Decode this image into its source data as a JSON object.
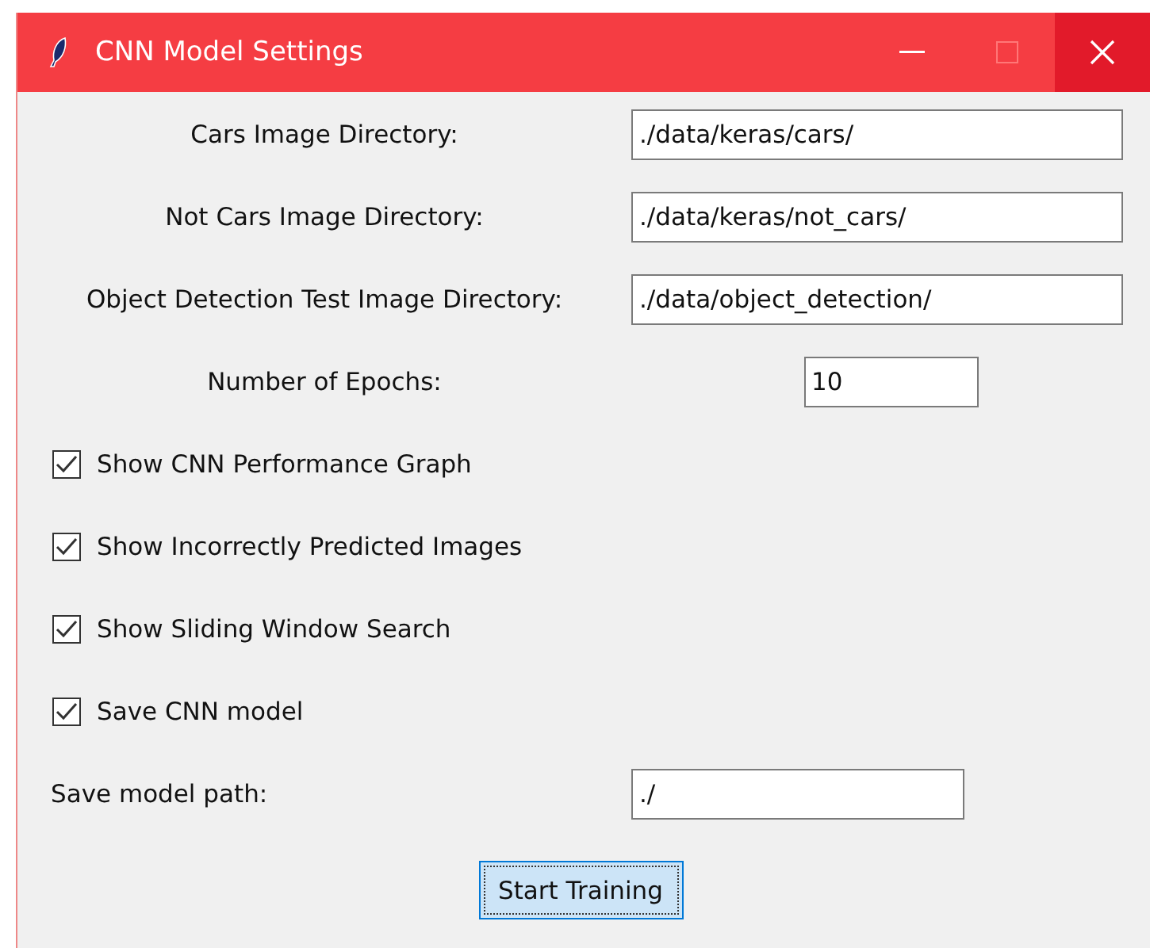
{
  "window": {
    "title": "CNN Model Settings"
  },
  "fields": [
    {
      "label": "Cars Image Directory:",
      "value": "./data/keras/cars/",
      "kind": "wide"
    },
    {
      "label": "Not Cars Image Directory:",
      "value": "./data/keras/not_cars/",
      "kind": "wide"
    },
    {
      "label": "Object Detection Test Image Directory:",
      "value": "./data/object_detection/",
      "kind": "wide"
    },
    {
      "label": "Number of Epochs:",
      "value": "10",
      "kind": "short"
    }
  ],
  "checkboxes": [
    {
      "label": "Show CNN Performance Graph",
      "checked": true
    },
    {
      "label": "Show Incorrectly Predicted Images",
      "checked": true
    },
    {
      "label": "Show Sliding Window Search",
      "checked": true
    },
    {
      "label": "Save CNN model",
      "checked": true
    }
  ],
  "save_path": {
    "label": "Save model path:",
    "value": "./"
  },
  "button": {
    "label": "Start Training"
  }
}
